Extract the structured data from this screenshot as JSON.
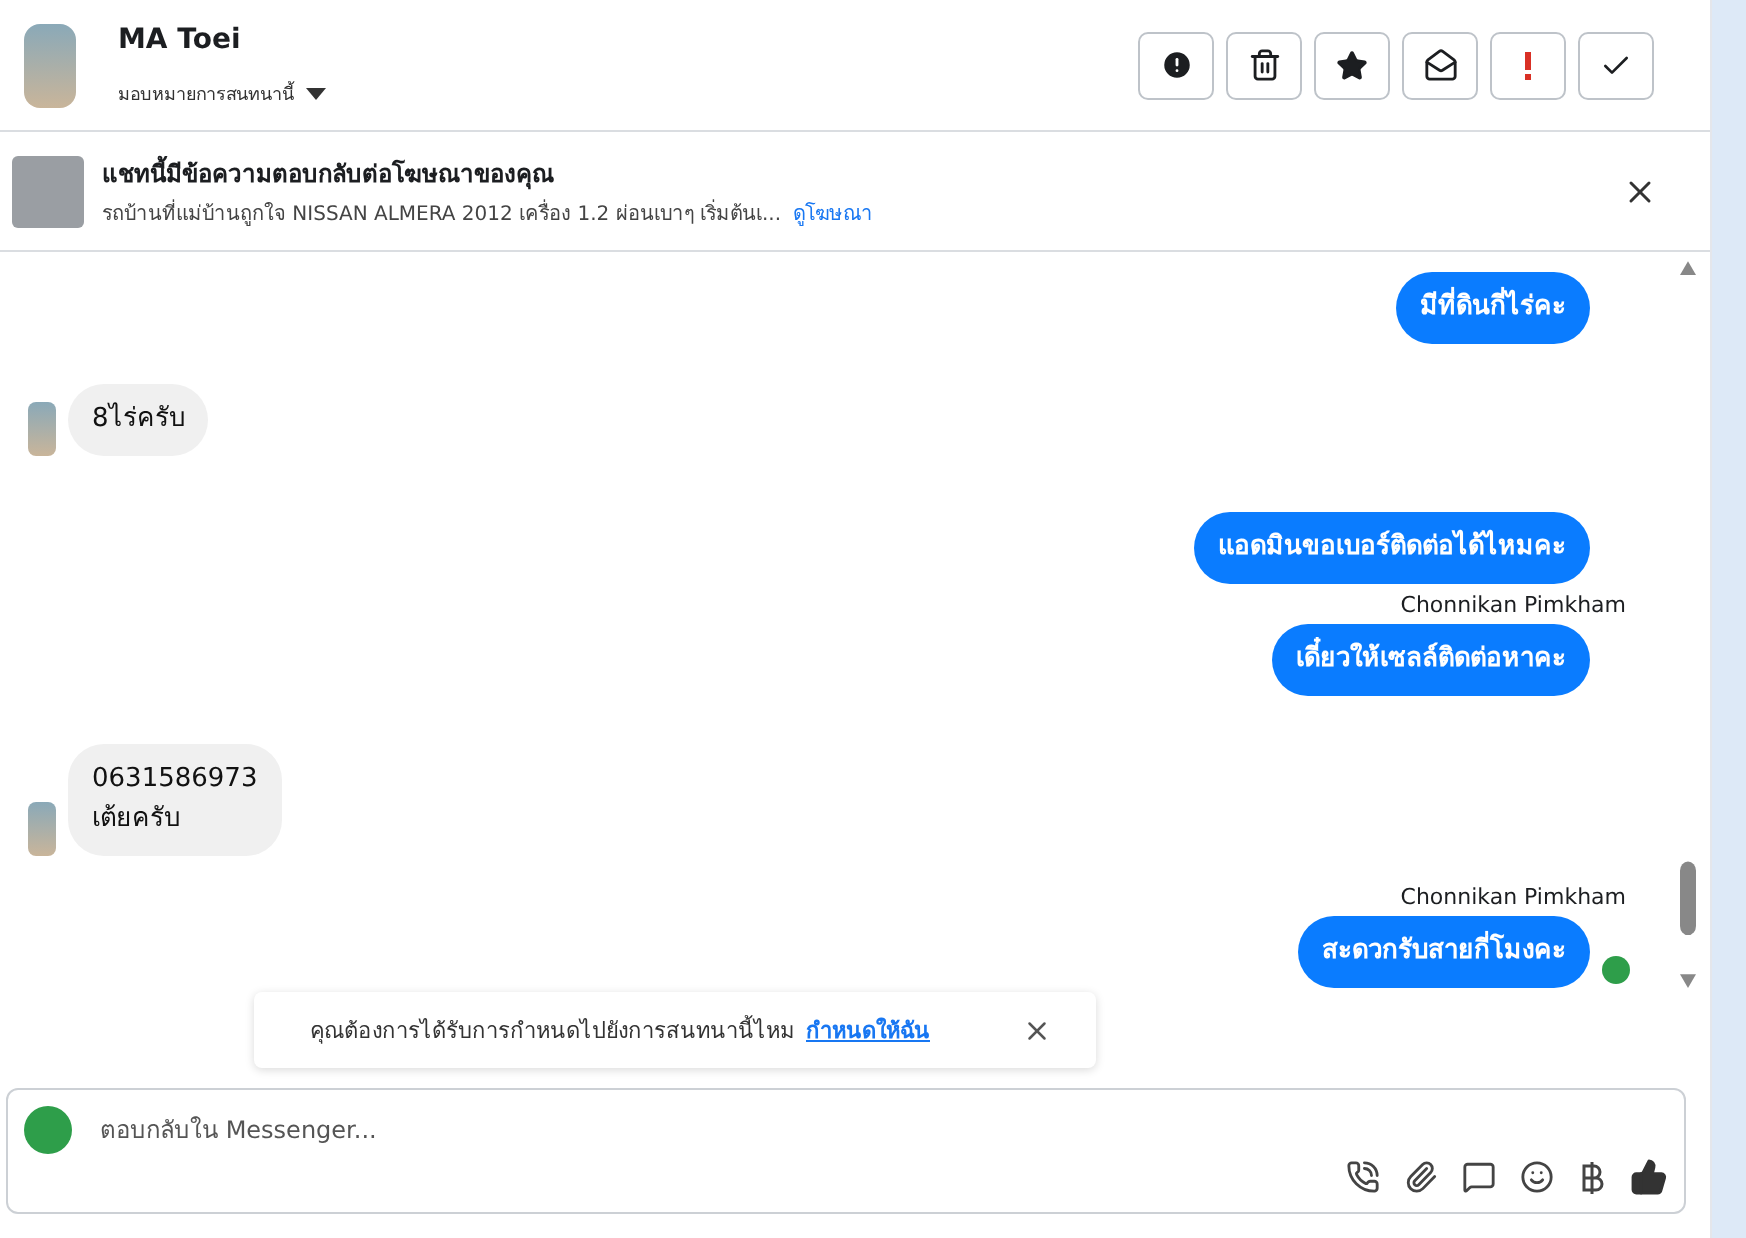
{
  "header": {
    "name": "MA Toei",
    "assign_label": "มอบหมายการสนทนานี้"
  },
  "ad_banner": {
    "title": "แชทนี้มีข้อความตอบกลับต่อโฆษณาของคุณ",
    "description": "รถบ้านที่แม่บ้านถูกใจ NISSAN ALMERA 2012 เครื่อง 1.2 ผ่อนเบาๆ เริ่มต้นเ...",
    "link": "ดูโฆษณา"
  },
  "messages": [
    {
      "kind": "outgoing",
      "lines": [
        "มีที่ดินกี่ไร่คะ"
      ],
      "seen": false
    },
    {
      "kind": "incoming",
      "lines": [
        "8ไร่ครับ"
      ]
    },
    {
      "kind": "outgoing",
      "lines": [
        "แอดมินขอเบอร์ติดต่อได้ไหมคะ"
      ],
      "seen": false
    },
    {
      "kind": "outgoing",
      "sender": "Chonnikan Pimkham",
      "lines": [
        "เดี๋ยวให้เซลล์ติดต่อหาคะ"
      ],
      "seen": false
    },
    {
      "kind": "incoming",
      "lines": [
        "0631586973",
        "เต้ยครับ"
      ]
    },
    {
      "kind": "outgoing",
      "sender": "Chonnikan Pimkham",
      "lines": [
        "สะดวกรับสายกี่โมงคะ"
      ],
      "seen": true
    }
  ],
  "toast": {
    "text": "คุณต้องการได้รับการกำหนดไปยังการสนทนานี้ไหม",
    "link": "กำหนดให้ฉัน"
  },
  "composer": {
    "placeholder": "ตอบกลับใน Messenger..."
  }
}
